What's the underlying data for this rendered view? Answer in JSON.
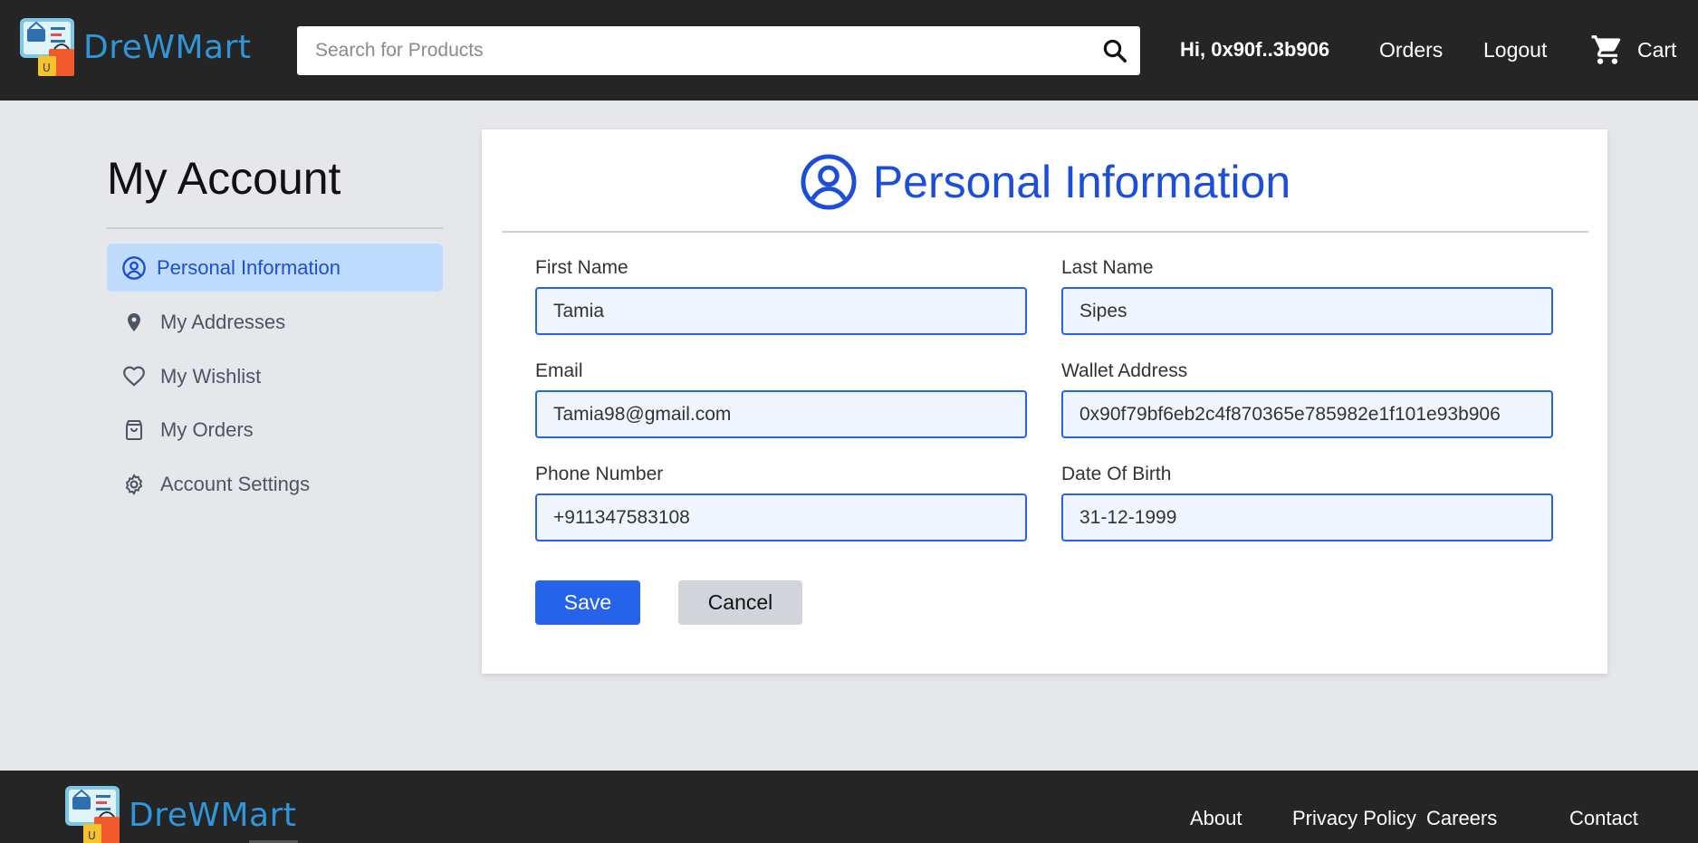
{
  "header": {
    "brand": "DreWMart",
    "search_placeholder": "Search for Products",
    "greeting": "Hi, 0x90f..3b906",
    "orders_label": "Orders",
    "logout_label": "Logout",
    "cart_label": "Cart"
  },
  "sidebar": {
    "title": "My Account",
    "items": [
      {
        "label": "Personal Information",
        "icon": "user-circle-icon",
        "active": true
      },
      {
        "label": "My Addresses",
        "icon": "map-pin-icon",
        "active": false
      },
      {
        "label": "My Wishlist",
        "icon": "heart-icon",
        "active": false
      },
      {
        "label": "My Orders",
        "icon": "shopping-bag-icon",
        "active": false
      },
      {
        "label": "Account Settings",
        "icon": "gear-icon",
        "active": false
      }
    ]
  },
  "form": {
    "title": "Personal Information",
    "first_name": {
      "label": "First Name",
      "value": "Tamia"
    },
    "last_name": {
      "label": "Last Name",
      "value": "Sipes"
    },
    "email": {
      "label": "Email",
      "value": "Tamia98@gmail.com"
    },
    "wallet": {
      "label": "Wallet Address",
      "value": "0x90f79bf6eb2c4f870365e785982e1f101e93b906"
    },
    "phone": {
      "label": "Phone Number",
      "value": "+911347583108"
    },
    "dob": {
      "label": "Date Of Birth",
      "value": "31-12-1999"
    },
    "save_label": "Save",
    "cancel_label": "Cancel"
  },
  "footer": {
    "brand": "DreWMart",
    "links": [
      "About",
      "Privacy Policy",
      "Careers",
      "Contact"
    ]
  },
  "colors": {
    "header_bg": "#252525",
    "page_bg": "#e5e7eb",
    "accent": "#2563eb",
    "active_bg": "#bfdbfe",
    "brand_text": "#2f97d9"
  }
}
